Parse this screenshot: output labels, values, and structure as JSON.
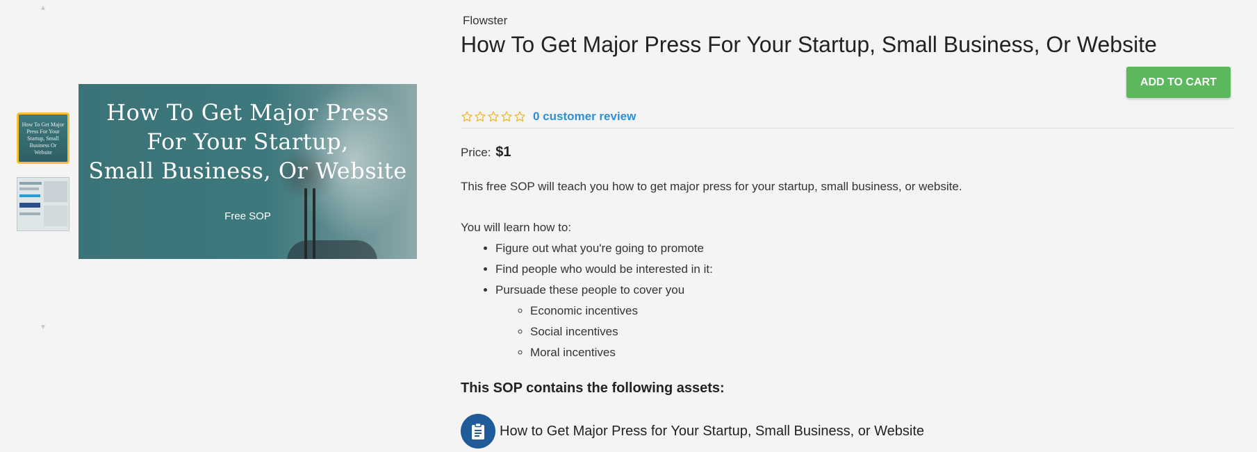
{
  "gallery": {
    "thumbnails": [
      {
        "alt": "How To Get Major Press For Your Startup, Small Business Or Website",
        "selected": true
      },
      {
        "alt": "SOP screenshot",
        "selected": false
      }
    ],
    "hero": {
      "title_line1": "How To Get Major Press",
      "title_line2": "For Your Startup,",
      "title_line3": "Small Business, Or Website",
      "subtitle": "Free SOP"
    }
  },
  "product": {
    "vendor": "Flowster",
    "title": "How To Get Major Press For Your Startup, Small Business, Or Website",
    "add_to_cart_label": "ADD TO CART",
    "rating": {
      "value": 0,
      "max": 5,
      "review_link": "0 customer review"
    },
    "price_label": "Price:",
    "price_value": "$1",
    "intro": "This free SOP will teach you how to get major press for your startup, small business, or website.",
    "learn_heading": "You will learn how to:",
    "learn_items": [
      "Figure out what you're going to promote",
      "Find people who would be interested in it:",
      "Pursuade these people to cover you"
    ],
    "incentives": [
      "Economic incentives",
      "Social incentives",
      "Moral incentives"
    ],
    "assets_heading": "This SOP contains the following assets:",
    "assets": [
      {
        "icon": "clipboard-icon",
        "title": "How to Get Major Press for Your Startup, Small Business, or Website"
      }
    ]
  },
  "colors": {
    "background": "#f4f4f4",
    "add_to_cart": "#5cb85c",
    "link": "#2b8fd9",
    "star": "#f0b323",
    "asset_icon_bg": "#1f5a99",
    "selected_thumb_border": "#f2c230"
  }
}
